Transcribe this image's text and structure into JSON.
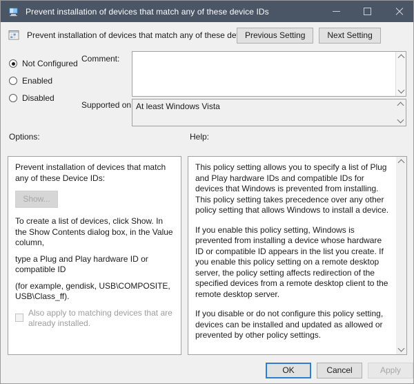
{
  "window": {
    "title": "Prevent installation of devices that match any of these device IDs",
    "icon": "group-policy-icon",
    "controls": {
      "minimize": "minimize-icon",
      "maximize": "maximize-icon",
      "close": "close-icon"
    }
  },
  "header": {
    "icon": "policy-setting-icon",
    "setting_title": "Prevent installation of devices that match any of these device IDs",
    "previous_setting": "Previous Setting",
    "next_setting": "Next Setting"
  },
  "state": {
    "options": [
      {
        "label": "Not Configured",
        "selected": true
      },
      {
        "label": "Enabled",
        "selected": false
      },
      {
        "label": "Disabled",
        "selected": false
      }
    ]
  },
  "comment": {
    "label": "Comment:",
    "value": "",
    "scrollbar": "vertical-scrollbar"
  },
  "supported_on": {
    "label": "Supported on:",
    "value": "At least Windows Vista",
    "scrollbar": "vertical-scrollbar"
  },
  "options_panel": {
    "label": "Options:",
    "heading": "Prevent installation of devices that match any of these Device IDs:",
    "show_button": "Show...",
    "show_button_enabled": false,
    "line1": "To create a list of devices, click Show. In the Show Contents dialog box, in the Value column,",
    "line2": "type a Plug and Play hardware ID or compatible ID",
    "line3": "(for example, gendisk, USB\\COMPOSITE, USB\\Class_ff).",
    "checkbox_label": "Also apply to matching devices that are already installed.",
    "checkbox_checked": false
  },
  "help_panel": {
    "label": "Help:",
    "paragraphs": [
      "This policy setting allows you to specify a list of Plug and Play hardware IDs and compatible IDs for devices that Windows is prevented from installing. This policy setting takes precedence over any other policy setting that allows Windows to install a device.",
      "If you enable this policy setting, Windows is prevented from installing a device whose hardware ID or compatible ID appears in the list you create. If you enable this policy setting on a remote desktop server, the policy setting affects redirection of the specified devices from a remote desktop client to the remote desktop server.",
      "If you disable or do not configure this policy setting, devices can be installed and updated as allowed or prevented by other policy settings."
    ],
    "scrollbar": "vertical-scrollbar"
  },
  "footer": {
    "ok": "OK",
    "cancel": "Cancel",
    "apply": "Apply",
    "apply_enabled": false
  },
  "colors": {
    "titlebar": "#4a5566",
    "dialog_background": "#f0f0f0",
    "focus_border": "#2d7cd6",
    "disabled_text": "#a6a6a6"
  }
}
